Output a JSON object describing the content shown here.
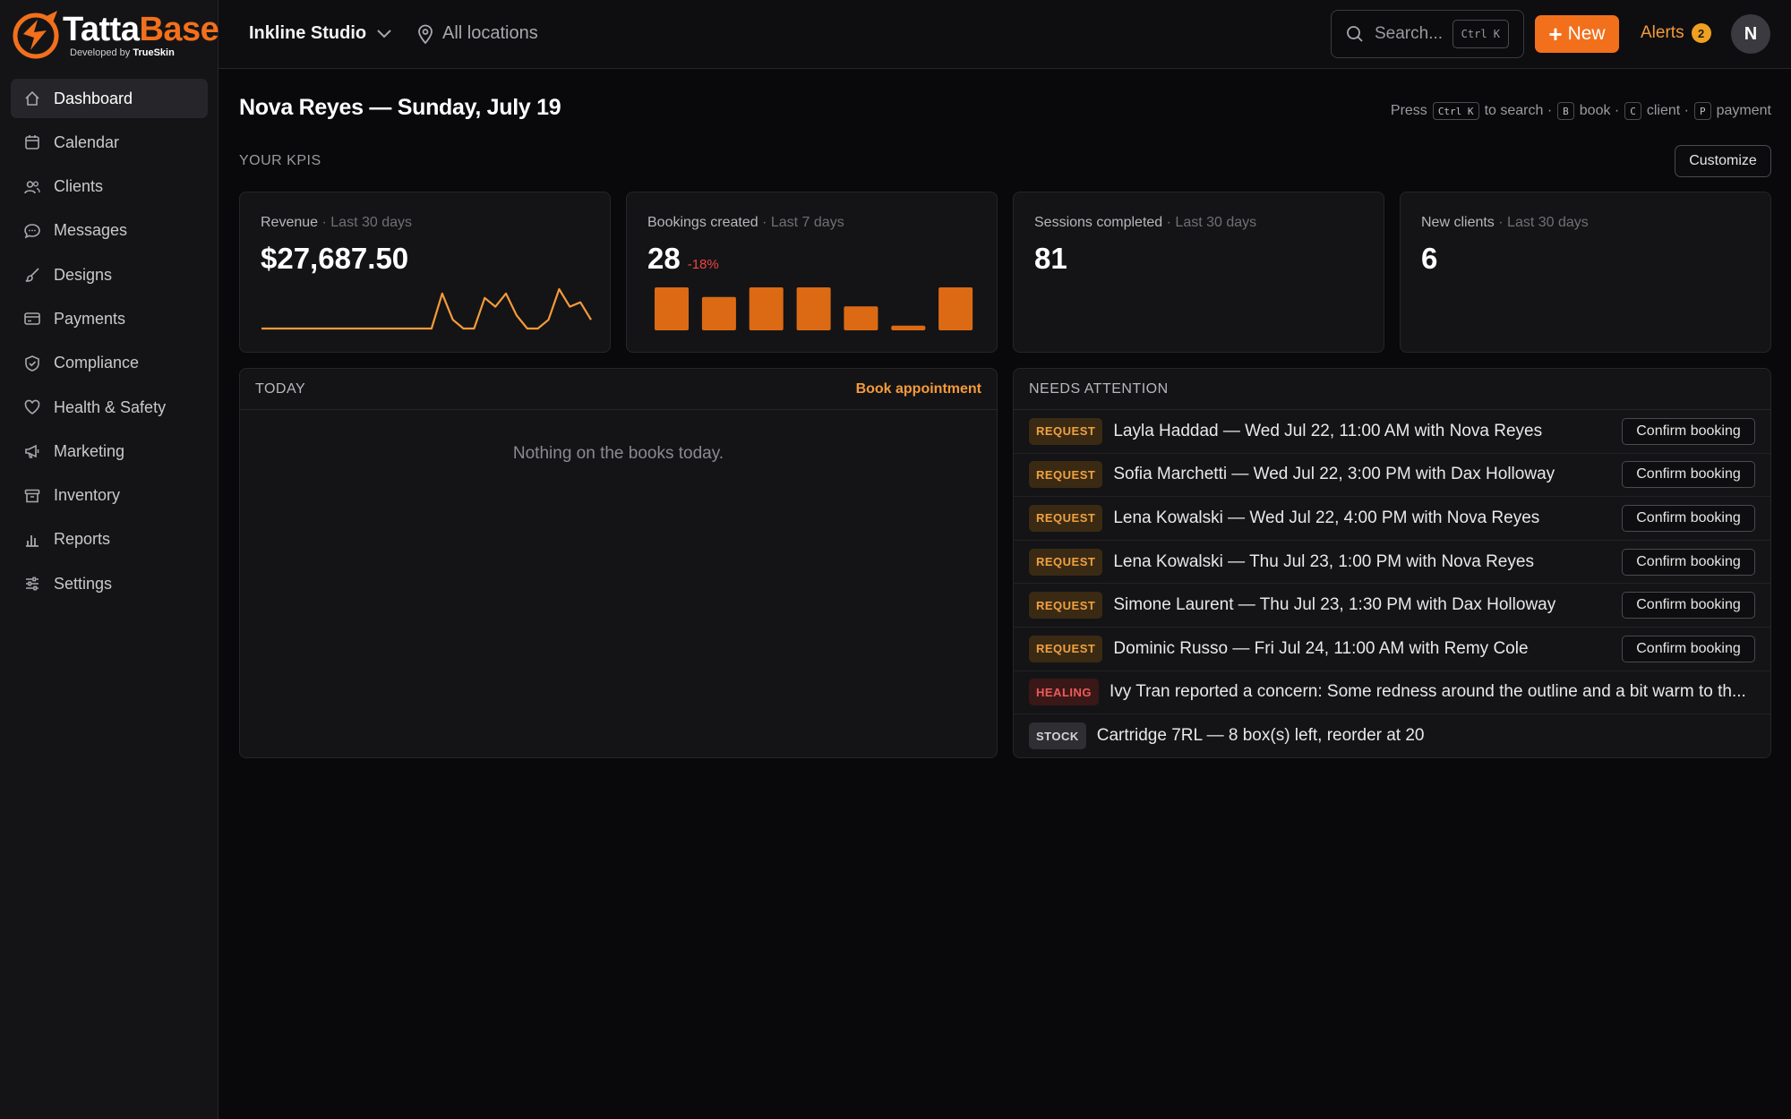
{
  "brand": {
    "name_part1": "Tatta",
    "name_part2": "Base",
    "tagline_prefix": "Developed by",
    "tagline_brand": "TrueSkin",
    "accent_color": "#f2701c"
  },
  "sidebar": {
    "items": [
      {
        "label": "Dashboard",
        "icon": "home-icon",
        "active": true
      },
      {
        "label": "Calendar",
        "icon": "calendar-icon"
      },
      {
        "label": "Clients",
        "icon": "users-icon"
      },
      {
        "label": "Messages",
        "icon": "message-icon"
      },
      {
        "label": "Designs",
        "icon": "brush-icon"
      },
      {
        "label": "Payments",
        "icon": "credit-card-icon"
      },
      {
        "label": "Compliance",
        "icon": "shield-icon"
      },
      {
        "label": "Health & Safety",
        "icon": "heart-icon"
      },
      {
        "label": "Marketing",
        "icon": "megaphone-icon"
      },
      {
        "label": "Inventory",
        "icon": "archive-icon"
      },
      {
        "label": "Reports",
        "icon": "bar-chart-icon"
      },
      {
        "label": "Settings",
        "icon": "sliders-icon"
      }
    ]
  },
  "topbar": {
    "studio": "Inkline Studio",
    "locations": "All locations",
    "search_placeholder": "Search...",
    "search_shortcut": "Ctrl K",
    "new_label": "New",
    "alerts_label": "Alerts",
    "alerts_count": "2",
    "avatar_initial": "N"
  },
  "header": {
    "title": "Nova Reyes — Sunday, July 19",
    "shortcuts": {
      "press": "Press",
      "k1": "Ctrl K",
      "t1": "to search ·",
      "k2": "B",
      "t2": "book ·",
      "k3": "C",
      "t3": "client ·",
      "k4": "P",
      "t4": "payment"
    },
    "kpis_label": "YOUR KPIS",
    "customize": "Customize"
  },
  "kpis": [
    {
      "label": "Revenue",
      "period": "· Last 30 days",
      "value": "$27,687.50",
      "spark": [
        0,
        0,
        0,
        0,
        0,
        0,
        0,
        0,
        0,
        0,
        0,
        0,
        0,
        0,
        0,
        0,
        0,
        8,
        2,
        0,
        0,
        7,
        5,
        8,
        3,
        0,
        0,
        2,
        9,
        5,
        6,
        2
      ]
    },
    {
      "label": "Bookings created",
      "period": "· Last 7 days",
      "value": "28",
      "delta": "-18%",
      "bars": [
        9,
        7,
        9,
        9,
        5,
        1,
        9
      ]
    },
    {
      "label": "Sessions completed",
      "period": "· Last 30 days",
      "value": "81"
    },
    {
      "label": "New clients",
      "period": "· Last 30 days",
      "value": "6"
    }
  ],
  "today": {
    "title": "TODAY",
    "action": "Book appointment",
    "empty": "Nothing on the books today."
  },
  "attention": {
    "title": "NEEDS ATTENTION",
    "confirm_label": "Confirm booking",
    "items": [
      {
        "tag": "REQUEST",
        "kind": "request",
        "text": "Layla Haddad — Wed Jul 22, 11:00 AM with Nova Reyes",
        "action": true
      },
      {
        "tag": "REQUEST",
        "kind": "request",
        "text": "Sofia Marchetti — Wed Jul 22, 3:00 PM with Dax Holloway",
        "action": true
      },
      {
        "tag": "REQUEST",
        "kind": "request",
        "text": "Lena Kowalski — Wed Jul 22, 4:00 PM with Nova Reyes",
        "action": true
      },
      {
        "tag": "REQUEST",
        "kind": "request",
        "text": "Lena Kowalski — Thu Jul 23, 1:00 PM with Nova Reyes",
        "action": true
      },
      {
        "tag": "REQUEST",
        "kind": "request",
        "text": "Simone Laurent — Thu Jul 23, 1:30 PM with Dax Holloway",
        "action": true
      },
      {
        "tag": "REQUEST",
        "kind": "request",
        "text": "Dominic Russo — Fri Jul 24, 11:00 AM with Remy Cole",
        "action": true
      },
      {
        "tag": "HEALING",
        "kind": "healing",
        "text": "Ivy Tran reported a concern: Some redness around the outline and a bit warm to th...",
        "action": false
      },
      {
        "tag": "STOCK",
        "kind": "stock",
        "text": "Cartridge 7RL — 8 box(s) left, reorder at 20",
        "action": false
      }
    ]
  }
}
